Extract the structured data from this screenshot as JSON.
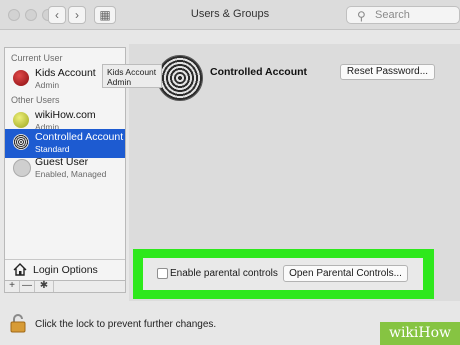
{
  "window": {
    "title": "Users & Groups"
  },
  "toolbar": {
    "back": "‹",
    "forward": "›",
    "grid": "▦",
    "search_placeholder": "Search"
  },
  "sidebar": {
    "current_user_header": "Current User",
    "other_users_header": "Other Users",
    "users": [
      {
        "name": "Kids Account",
        "role": "Admin",
        "avatar_color": "#b3131b",
        "selected": false
      },
      {
        "name": "wikiHow.com",
        "role": "Admin",
        "avatar_color": "#c9d43a",
        "selected": false
      },
      {
        "name": "Controlled Account",
        "role": "Standard",
        "avatar_color": "#7a7a7a",
        "selected": true
      },
      {
        "name": "Guest User",
        "role": "Enabled, Managed",
        "avatar_color": "#cfcfcf",
        "selected": false
      }
    ],
    "login_options": "Login Options",
    "add": "+",
    "remove": "—",
    "gear": "✱"
  },
  "tooltip": {
    "name": "Kids Account",
    "role": "Admin"
  },
  "main": {
    "account_name": "Controlled Account",
    "reset_password": "Reset Password...",
    "enable_parental_controls": "Enable parental controls",
    "open_parental_controls": "Open Parental Controls..."
  },
  "footer": {
    "lock_text": "Click the lock to prevent further changes."
  },
  "watermark": "wikiHow",
  "colors": {
    "highlight": "#2ee81c",
    "selection": "#1d5bd1"
  }
}
